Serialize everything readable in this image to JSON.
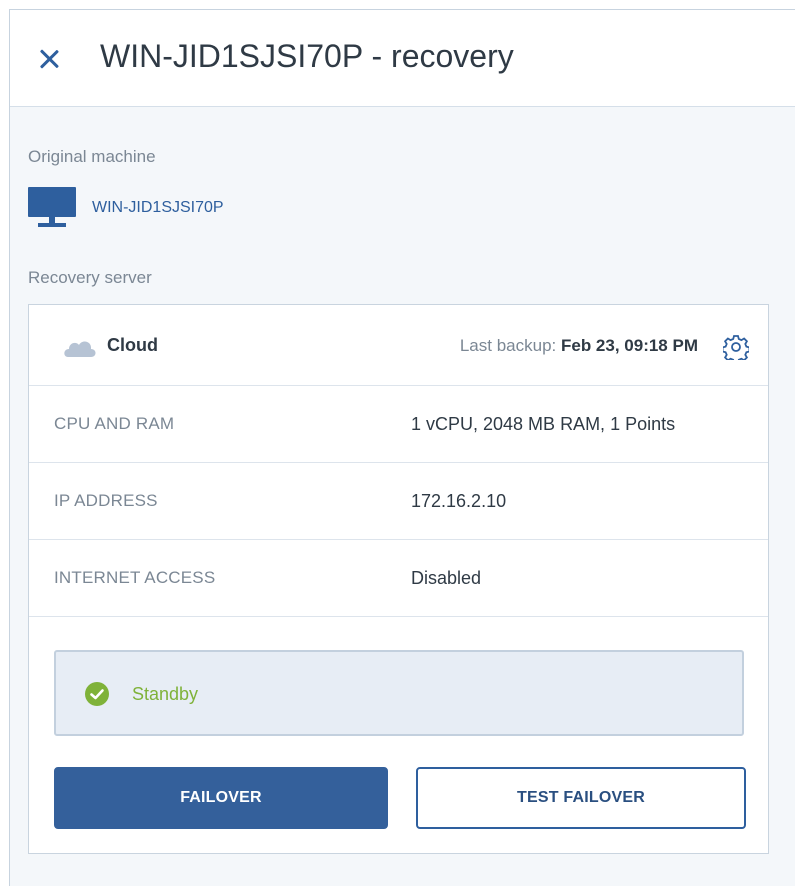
{
  "window": {
    "title": "WIN-JID1SJSI70P - recovery"
  },
  "original_machine": {
    "label": "Original machine",
    "name": "WIN-JID1SJSI70P",
    "icon": "monitor-icon"
  },
  "recovery_server": {
    "label": "Recovery server",
    "location_label": "Cloud",
    "location_icon": "cloud-icon",
    "last_backup_label": "Last backup:",
    "last_backup_value": "Feb 23, 09:18 PM",
    "settings_icon": "gear-icon",
    "properties": [
      {
        "label": "CPU AND RAM",
        "value": "1 vCPU, 2048 MB RAM, 1 Points"
      },
      {
        "label": "IP ADDRESS",
        "value": "172.16.2.10"
      },
      {
        "label": "INTERNET ACCESS",
        "value": "Disabled"
      }
    ],
    "status": {
      "text": "Standby",
      "icon": "check-circle-icon",
      "color": "#7fb239"
    },
    "actions": {
      "failover_label": "FAILOVER",
      "test_failover_label": "TEST FAILOVER"
    }
  },
  "colors": {
    "accent": "#2e5f9e",
    "primary_button": "#34609b",
    "status_ok": "#7fb239"
  }
}
